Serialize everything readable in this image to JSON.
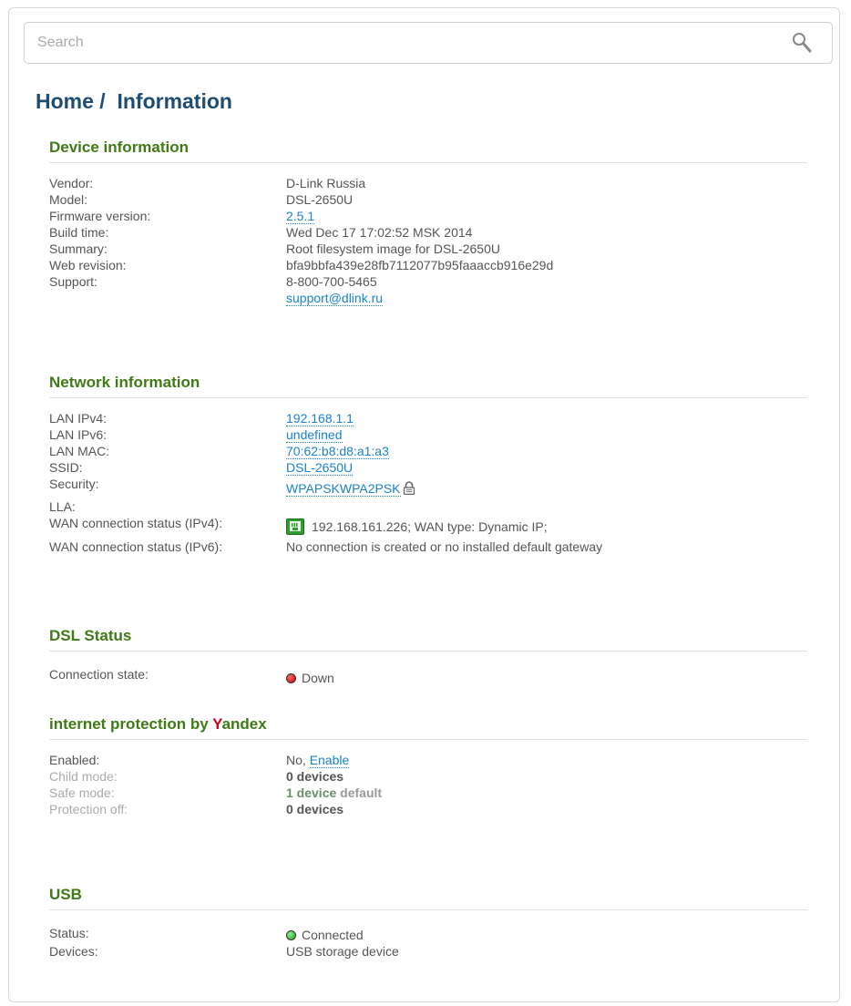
{
  "search": {
    "placeholder": "Search",
    "icon": "search-icon"
  },
  "breadcrumb": {
    "home": "Home",
    "separator": "/",
    "current": "Information"
  },
  "device_information": {
    "heading": "Device information",
    "rows": [
      {
        "label": "Vendor:",
        "value": "D-Link Russia"
      },
      {
        "label": "Model:",
        "value": "DSL-2650U"
      },
      {
        "label": "Firmware version:",
        "value": "2.5.1"
      },
      {
        "label": "Build time:",
        "value": "Wed Dec 17 17:02:52 MSK 2014"
      },
      {
        "label": "Summary:",
        "value": "Root filesystem image for DSL-2650U"
      },
      {
        "label": "Web revision:",
        "value": "bfa9bbfa439e28fb7112077b95faaaccb916e29d"
      },
      {
        "label": "Support:",
        "value": "8-800-700-5465",
        "value2": "support@dlink.ru"
      }
    ]
  },
  "network_information": {
    "heading": "Network information",
    "rows": [
      {
        "label": "LAN IPv4:",
        "value": "192.168.1.1"
      },
      {
        "label": "LAN IPv6:",
        "value": "undefined"
      },
      {
        "label": "LAN MAC:",
        "value": "70:62:b8:d8:a1:a3"
      },
      {
        "label": "SSID:",
        "value": "DSL-2650U"
      },
      {
        "label": "Security:",
        "value": "WPAPSKWPA2PSK"
      },
      {
        "label": "LLA:",
        "value": ""
      },
      {
        "label": "WAN connection status (IPv4):",
        "value": "192.168.161.226; WAN type: Dynamic IP;"
      },
      {
        "label": "WAN connection status (IPv6):",
        "value": "No connection is created or no installed default gateway"
      }
    ]
  },
  "dsl_status": {
    "heading": "DSL Status",
    "rows": [
      {
        "label": "Connection state:",
        "value": "Down",
        "indicator": "red"
      }
    ]
  },
  "yandex": {
    "heading_prefix": "internet protection by ",
    "heading_brand_first": "Y",
    "heading_brand_rest": "andex",
    "rows": [
      {
        "label": "Enabled:",
        "value": "No, ",
        "link": "Enable"
      },
      {
        "label": "Child mode:",
        "value": "0 devices"
      },
      {
        "label": "Safe mode:",
        "value": "1 device",
        "suffix": " default"
      },
      {
        "label": "Protection off:",
        "value": "0 devices"
      }
    ]
  },
  "usb": {
    "heading": "USB",
    "rows": [
      {
        "label": "Status:",
        "value": "Connected",
        "indicator": "green"
      },
      {
        "label": "Devices:",
        "value": "USB storage device"
      }
    ]
  },
  "colors": {
    "title": "#1f4d70",
    "section_heading": "#3f7a16",
    "link": "#1c83c6",
    "yandex_red": "#d6001c",
    "status_down": "#c40000",
    "status_connected": "#1f9f1f"
  }
}
